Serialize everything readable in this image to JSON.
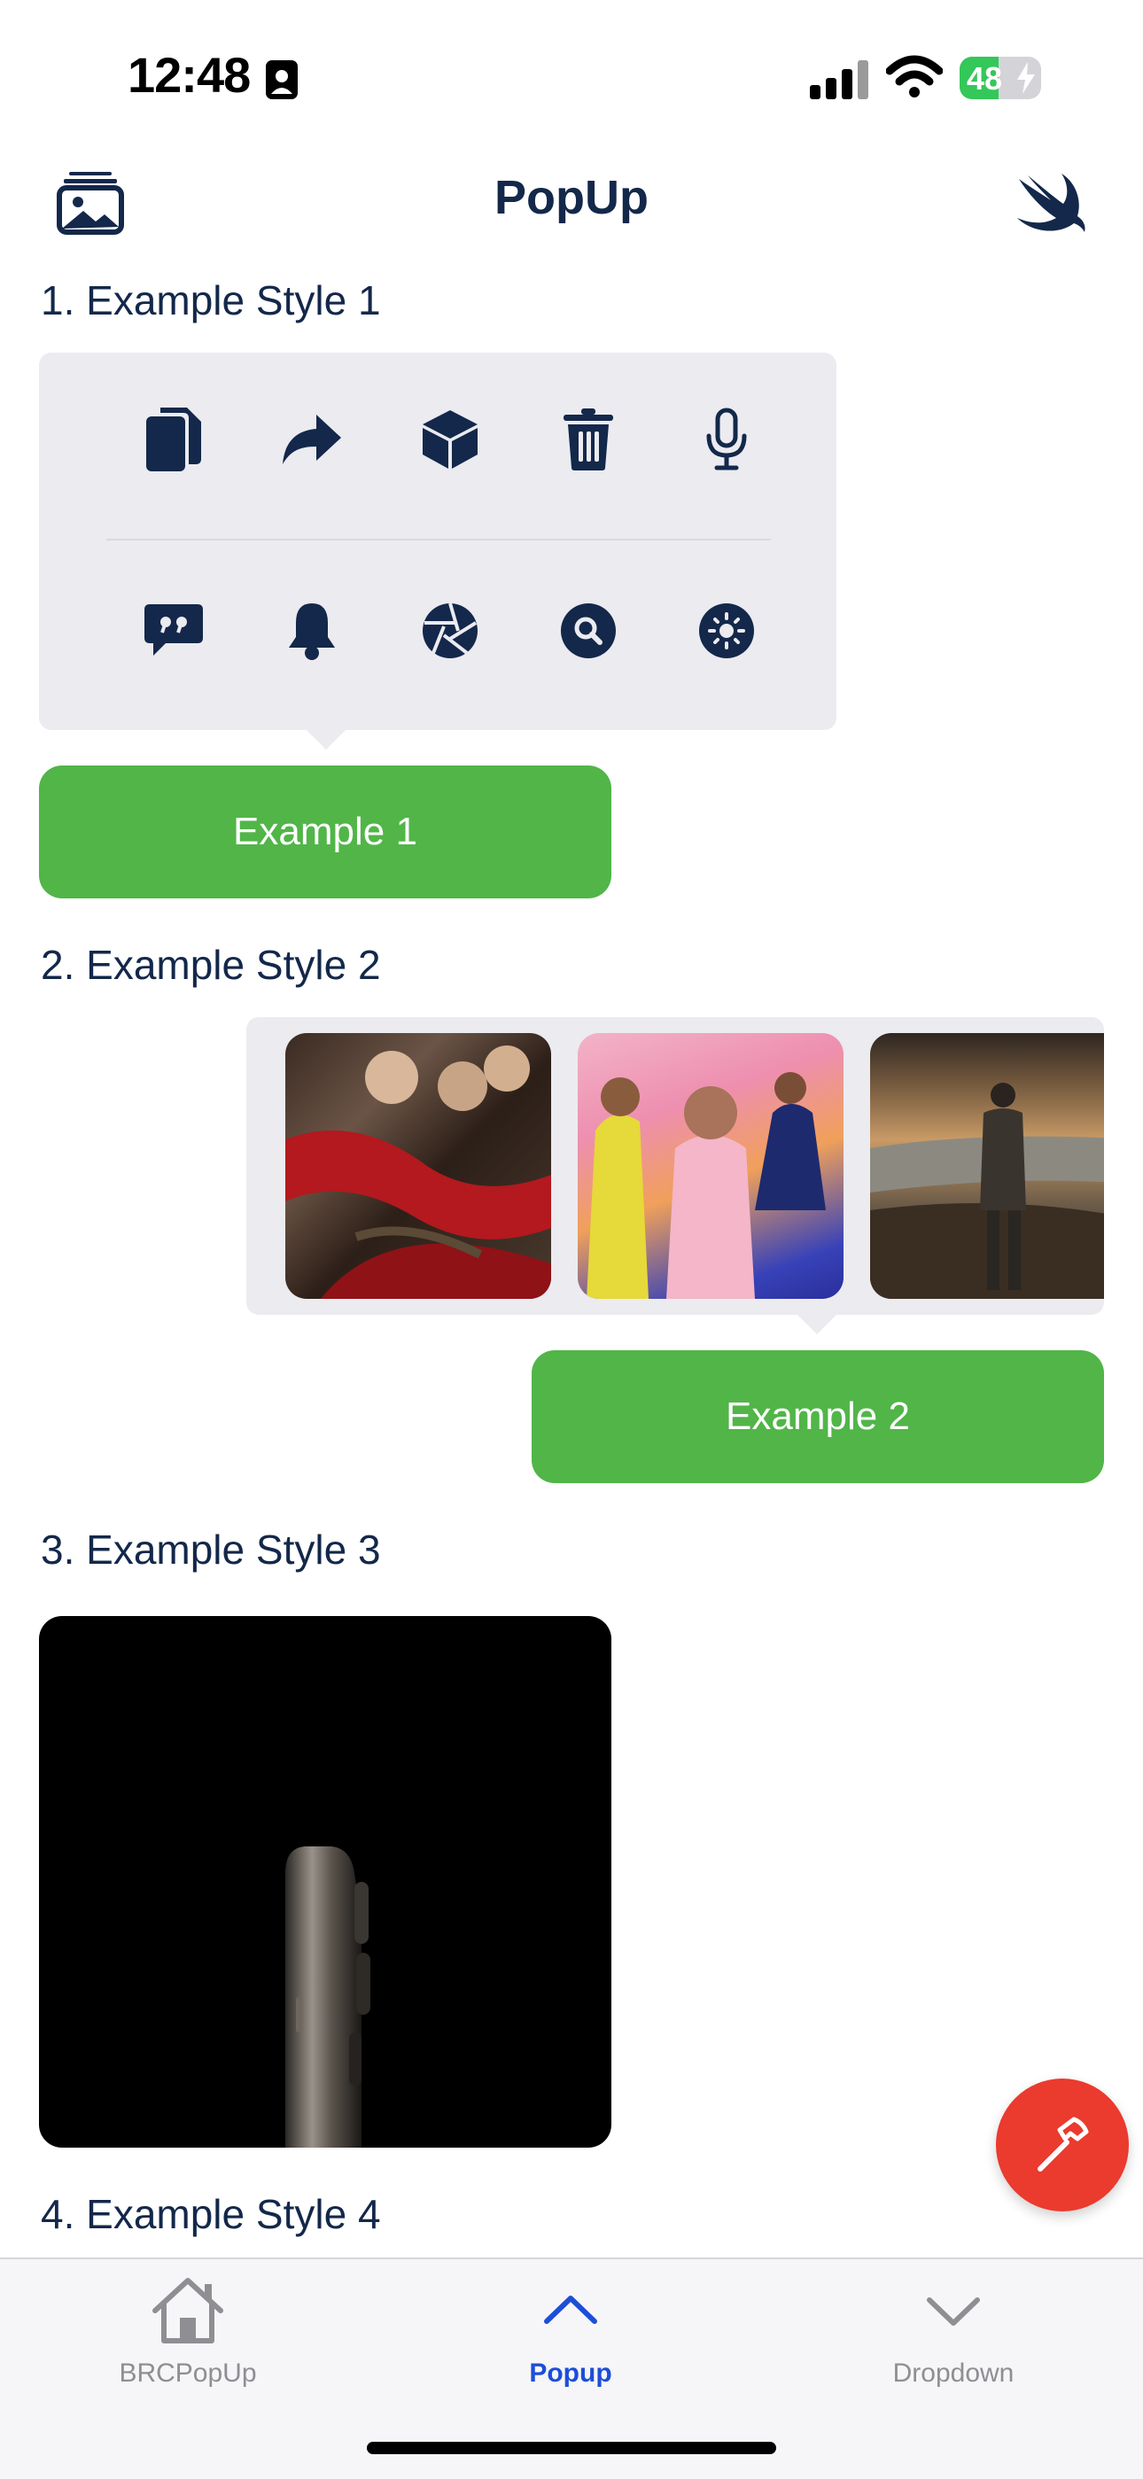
{
  "status_bar": {
    "time": "12:48",
    "battery_level": "48",
    "battery_fraction": 0.48
  },
  "nav": {
    "title": "PopUp",
    "left_icon": "photo-stack-icon",
    "right_icon": "swift-logo-icon"
  },
  "sections": [
    {
      "title": "1. Example Style 1",
      "button_label": "Example 1",
      "icons_row1": [
        "copy-icon",
        "share-arrow-icon",
        "cube-icon",
        "trash-icon",
        "microphone-icon"
      ],
      "icons_row2": [
        "quote-bubble-icon",
        "bell-icon",
        "aperture-icon",
        "magnifier-icon",
        "sun-icon"
      ]
    },
    {
      "title": "2. Example Style 2",
      "button_label": "Example 2"
    },
    {
      "title": "3. Example Style 3"
    },
    {
      "title": "4. Example Style 4"
    }
  ],
  "tabs": [
    {
      "label": "BRCPopUp",
      "icon": "house-icon",
      "selected": false
    },
    {
      "label": "Popup",
      "icon": "chevron-up-icon",
      "selected": true
    },
    {
      "label": "Dropdown",
      "icon": "chevron-down-icon",
      "selected": false
    }
  ],
  "fab": {
    "icon": "hammer-icon"
  },
  "colors": {
    "accent_green": "#51b548",
    "navy": "#13284a",
    "fab_red": "#eb3a2e",
    "tab_selected": "#1d4ed8",
    "tab_inactive": "#8e8e93"
  }
}
